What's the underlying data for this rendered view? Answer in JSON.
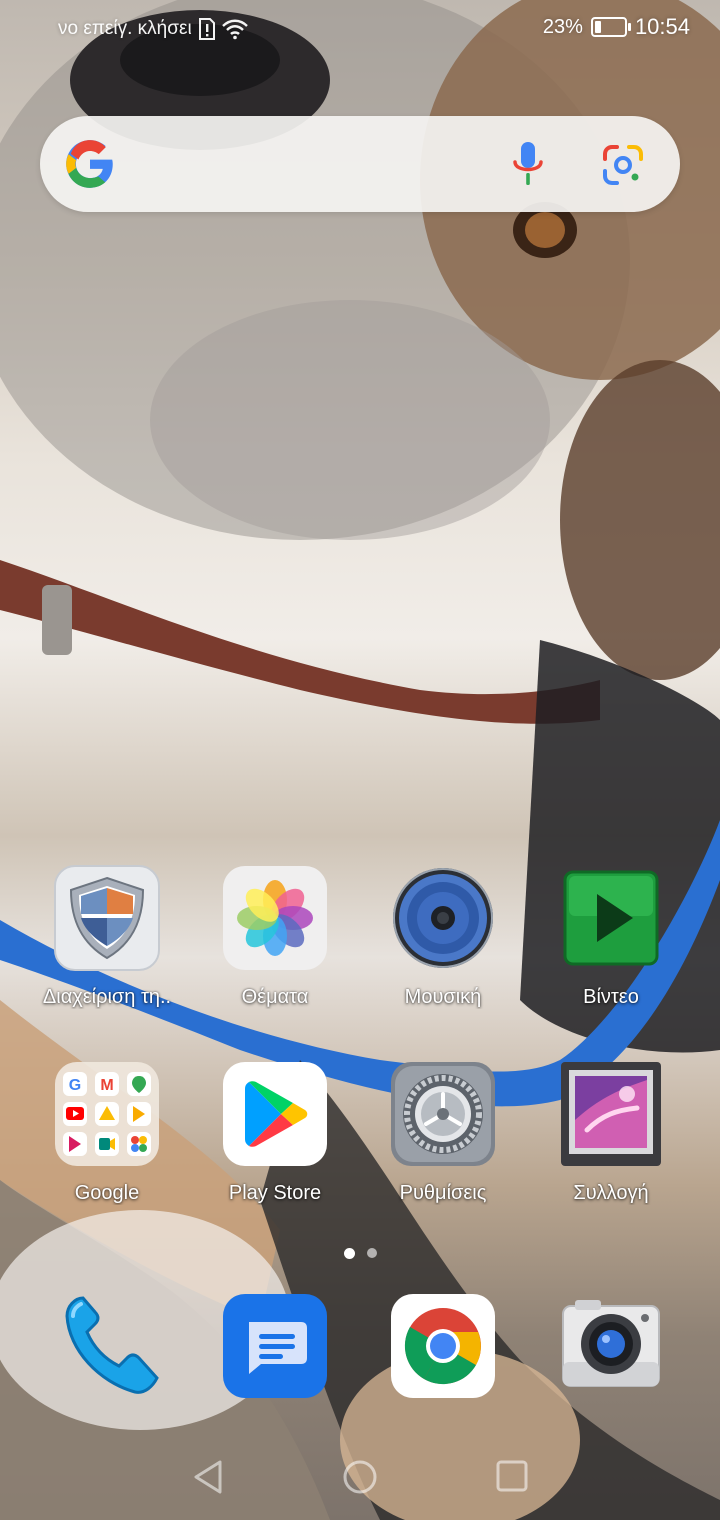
{
  "status_bar": {
    "carrier_text": "νο επείγ. κλήσει",
    "battery_percent": "23%",
    "battery_level": 0.23,
    "time": "10:54",
    "icons": [
      "sim-alert-icon",
      "wifi-icon",
      "battery-icon"
    ]
  },
  "search_widget": {
    "icons": [
      "google-logo-icon",
      "microphone-icon",
      "google-lens-icon"
    ]
  },
  "home_apps": [
    {
      "label": "Διαχείριση τη..",
      "icon": "shield-icon"
    },
    {
      "label": "Θέματα",
      "icon": "themes-flower-icon"
    },
    {
      "label": "Μουσική",
      "icon": "speaker-icon"
    },
    {
      "label": "Βίντεο",
      "icon": "play-icon"
    },
    {
      "label": "Google",
      "icon": "google-folder-icon"
    },
    {
      "label": "Play Store",
      "icon": "play-store-icon"
    },
    {
      "label": "Ρυθμίσεις",
      "icon": "settings-gear-icon"
    },
    {
      "label": "Συλλογή",
      "icon": "gallery-icon"
    }
  ],
  "page_indicator": {
    "pages": 2,
    "current": 1
  },
  "dock": [
    {
      "icon": "phone-icon"
    },
    {
      "icon": "messages-icon"
    },
    {
      "icon": "chrome-icon"
    },
    {
      "icon": "camera-icon"
    }
  ],
  "navigation": [
    "back-icon",
    "home-icon",
    "recents-icon"
  ],
  "colors": {
    "label_text": "#ffffff",
    "search_bg": "#f5f4f2",
    "collar_blue": "#2a6fd1",
    "collar_brown": "#7a3b2e"
  }
}
